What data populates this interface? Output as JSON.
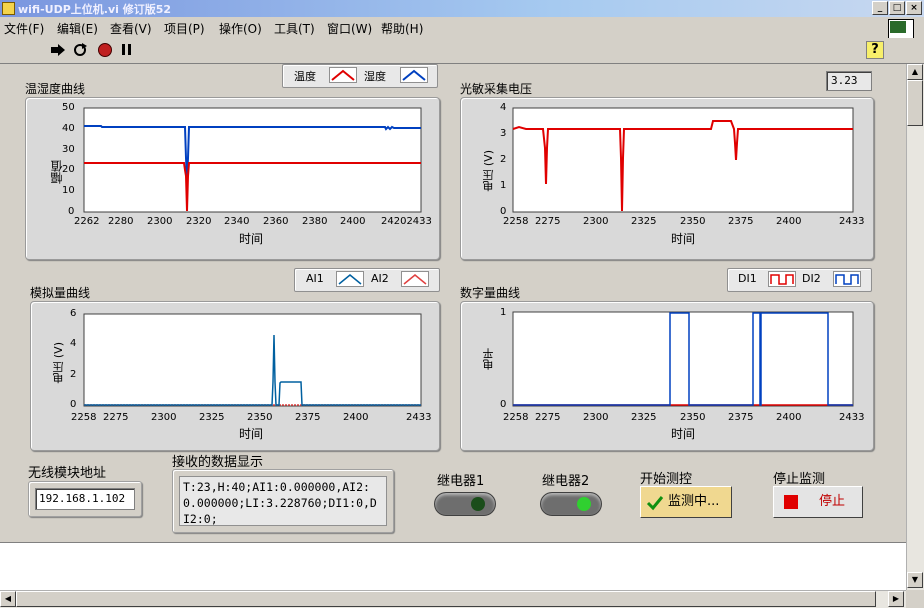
{
  "window": {
    "title": "wifi-UDP上位机.vi 修订版52"
  },
  "menu": [
    "文件(F)",
    "编辑(E)",
    "查看(V)",
    "项目(P)",
    "操作(O)",
    "工具(T)",
    "窗口(W)",
    "帮助(H)"
  ],
  "toolbar": {
    "help_glyph": "?",
    "vi_badge": "1"
  },
  "temp_chart": {
    "label": "温湿度曲线",
    "legend": [
      "温度",
      "湿度"
    ],
    "ylabel": "幅值",
    "xlabel": "时间",
    "yticks": [
      "50",
      "40",
      "30",
      "20",
      "10",
      "0"
    ],
    "xticks": [
      "2262",
      "2280",
      "2300",
      "2320",
      "2340",
      "2360",
      "2380",
      "2400",
      "24202433"
    ]
  },
  "light_chart": {
    "label": "光敏采集电压",
    "readout": "3.23",
    "ylabel": "电压 (V)",
    "xlabel": "时间",
    "yticks": [
      "4",
      "3",
      "2",
      "1",
      "0"
    ],
    "xticks": [
      "2258",
      "2275",
      "2300",
      "2325",
      "2350",
      "2375",
      "2400",
      "2433"
    ]
  },
  "analog_chart": {
    "label": "模拟量曲线",
    "legend": [
      "AI1",
      "AI2"
    ],
    "ylabel": "电压 (V)",
    "xlabel": "时间",
    "yticks": [
      "6",
      "4",
      "2",
      "0"
    ],
    "xticks": [
      "2258",
      "2275",
      "2300",
      "2325",
      "2350",
      "2375",
      "2400",
      "2433"
    ]
  },
  "digital_chart": {
    "label": "数字量曲线",
    "legend": [
      "DI1",
      "DI2"
    ],
    "ylabel": "电平",
    "xlabel": "时间",
    "yticks": [
      "1",
      "0"
    ],
    "xticks": [
      "2258",
      "2275",
      "2300",
      "2325",
      "2350",
      "2375",
      "2400",
      "2433"
    ]
  },
  "address": {
    "label": "无线模块地址",
    "value": "192.168.1.102"
  },
  "received": {
    "label": "接收的数据显示",
    "text": "T:23,H:40;AI1:0.000000,AI2:0.000000;LI:3.228760;DI1:0,DI2:0;"
  },
  "relay1": {
    "label": "继电器1"
  },
  "relay2": {
    "label": "继电器2"
  },
  "start": {
    "label": "开始测控",
    "button": "监测中..."
  },
  "stop": {
    "label": "停止监测",
    "button": "停止"
  },
  "colors": {
    "temperature": "#e00000",
    "humidity": "#0040c0",
    "relay_off": "#1a4d1a",
    "relay_on": "#30d030"
  }
}
